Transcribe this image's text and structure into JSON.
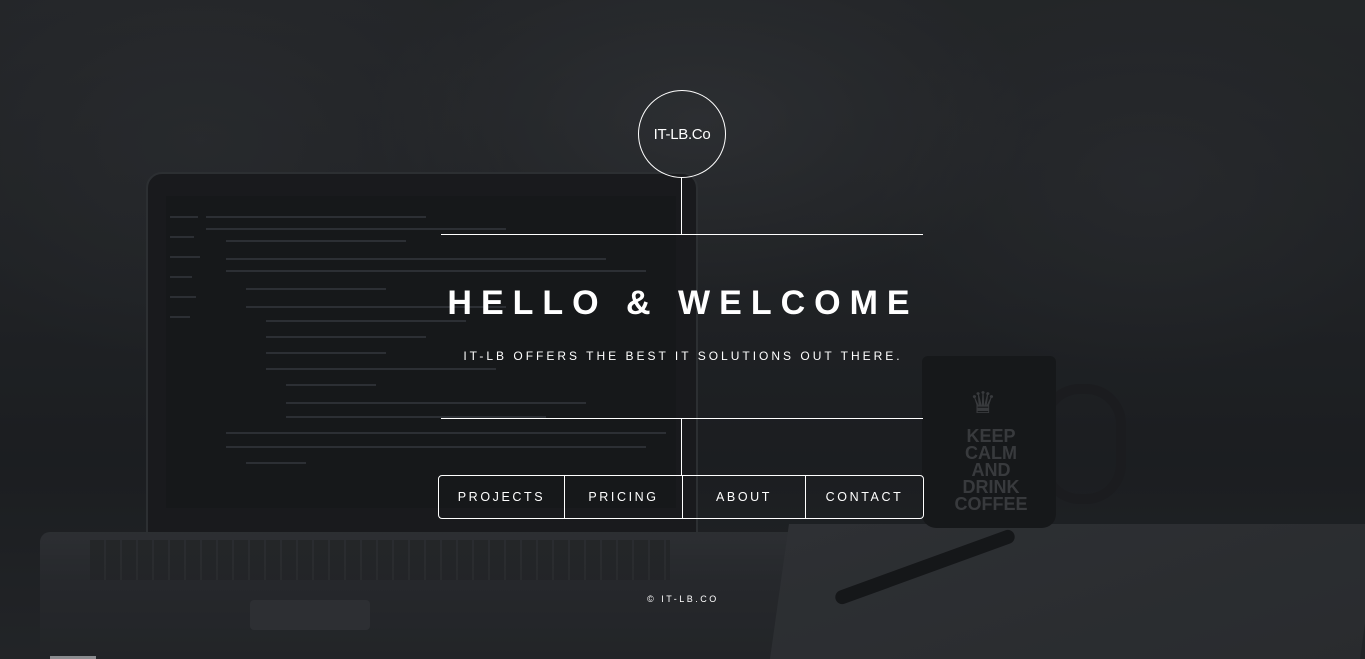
{
  "brand": {
    "logo_text": "IT-LB.Co"
  },
  "hero": {
    "title": "HELLO & WELCOME",
    "subtitle": "IT-LB OFFERS THE BEST IT SOLUTIONS OUT THERE."
  },
  "nav": {
    "items": [
      {
        "label": "PROJECTS"
      },
      {
        "label": "PRICING"
      },
      {
        "label": "ABOUT"
      },
      {
        "label": "CONTACT"
      }
    ]
  },
  "footer": {
    "copyright": "© IT-LB.CO"
  },
  "background": {
    "mug_text": "KEEP CALM AND DRINK COFFEE"
  },
  "colors": {
    "foreground": "#ffffff",
    "background": "#26282b"
  }
}
